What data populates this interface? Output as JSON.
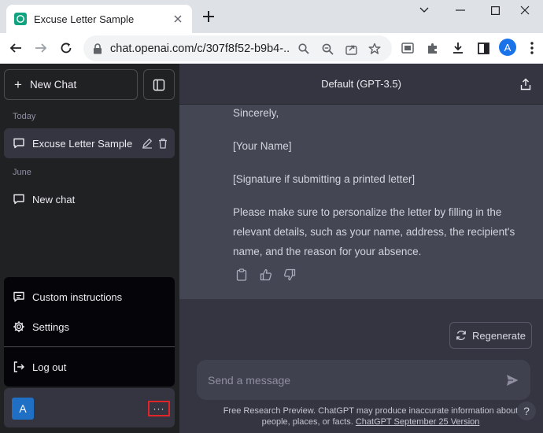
{
  "browser": {
    "tab_title": "Excuse Letter Sample",
    "url": "chat.openai.com/c/307f8f52-b9b4-...",
    "profile_initial": "A"
  },
  "sidebar": {
    "new_chat_label": "New Chat",
    "sections": [
      {
        "label": "Today",
        "items": [
          {
            "label": "Excuse Letter Sample",
            "active": true
          }
        ]
      },
      {
        "label": "June",
        "items": [
          {
            "label": "New chat",
            "active": false
          }
        ]
      }
    ],
    "menu": {
      "custom_instructions": "Custom instructions",
      "settings": "Settings",
      "logout": "Log out"
    },
    "user_initial": "A",
    "more_label": "···"
  },
  "main": {
    "model_title": "Default (GPT-3.5)",
    "message_lines": [
      "Sincerely,",
      "[Your Name]",
      "[Signature if submitting a printed letter]",
      "Please make sure to personalize the letter by filling in the relevant details, such as your name, address, the recipient's name, and the reason for your absence."
    ],
    "regenerate_label": "Regenerate",
    "input_placeholder": "Send a message",
    "footer_text": "Free Research Preview. ChatGPT may produce inaccurate information about people, places, or facts.",
    "footer_link": "ChatGPT September 25 Version",
    "help_label": "?"
  },
  "colors": {
    "sidebar_bg": "#202123",
    "main_bg": "#343541",
    "assistant_bg": "#444654",
    "highlight_border": "#e0252a"
  }
}
